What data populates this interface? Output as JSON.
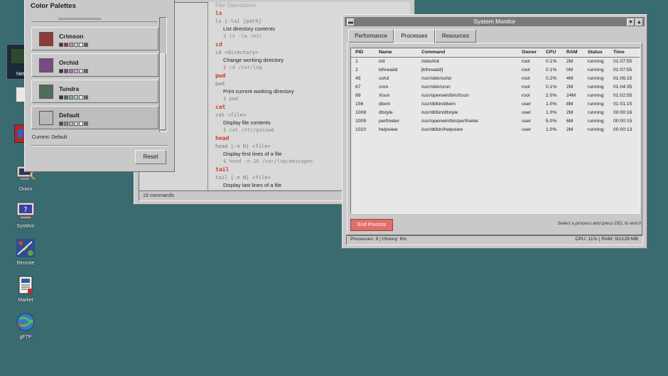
{
  "desktop": {
    "icons": [
      {
        "label": "Onion",
        "icon": "onion-icon"
      },
      {
        "label": "SysMon",
        "icon": "sysmon-icon"
      },
      {
        "label": "Remote",
        "icon": "remote-icon"
      },
      {
        "label": "Market",
        "icon": "market-icon"
      },
      {
        "label": "gFTP",
        "icon": "gftp-icon"
      }
    ],
    "partial_icons": [
      {
        "label": "Net",
        "icon": "netscape-icon"
      }
    ]
  },
  "commands_window": {
    "header": "File Operations",
    "status": "19 commands",
    "commands": [
      {
        "name": "ls",
        "syntax": "ls [-la] [path]",
        "desc": "List directory contents",
        "example": "$ ls -la /etc"
      },
      {
        "name": "cd",
        "syntax": "cd <directory>",
        "desc": "Change working directory",
        "example": "$ cd /var/log"
      },
      {
        "name": "pwd",
        "syntax": "pwd",
        "desc": "Print current working directory",
        "example": "$ pwd"
      },
      {
        "name": "cat",
        "syntax": "cat <file>",
        "desc": "Display file contents",
        "example": "$ cat /etc/passwd"
      },
      {
        "name": "head",
        "syntax": "head [-n N] <file>",
        "desc": "Display first lines of a file",
        "example": "$ head -n 20 /var/log/messages"
      },
      {
        "name": "tail",
        "syntax": "tail [-n N] <file>",
        "desc": "Display last lines of a file",
        "example": ""
      }
    ]
  },
  "palette_window": {
    "title": "Color Palettes",
    "palettes": [
      {
        "name": "Crimson",
        "swatch": "#8e3a3a",
        "dots": [
          "#5a2a2a",
          "#8e3a3a",
          "#c98c8c",
          "#e0c4c4",
          "#f2e8e8",
          "#7a5a5a"
        ]
      },
      {
        "name": "Orchid",
        "swatch": "#7a4a85",
        "dots": [
          "#3a2a45",
          "#7a4a85",
          "#a07ab0",
          "#c8aed2",
          "#e6daea",
          "#6a5a72"
        ]
      },
      {
        "name": "Tundra",
        "swatch": "#4f6e5c",
        "dots": [
          "#2a3a30",
          "#4f6e5c",
          "#8aa896",
          "#b8cbbf",
          "#e2ebe5",
          "#5a6a60"
        ]
      },
      {
        "name": "Default",
        "swatch": "#b8b8b8",
        "dots": [
          "#4a4a4a",
          "#8a8a8a",
          "#b8b8b8",
          "#d8d8d8",
          "#f2f2f2",
          "#6a6a6a"
        ]
      }
    ],
    "current": "Current: Default",
    "reset_label": "Reset"
  },
  "sysmon": {
    "title": "System Monitor",
    "tabs": [
      "Performance",
      "Processes",
      "Resources"
    ],
    "active_tab": "Processes",
    "columns": [
      "PID",
      "Name",
      "Command",
      "Owner",
      "CPU",
      "RAM",
      "Status",
      "Time"
    ],
    "rows": [
      [
        "1",
        "init",
        "/sbin/init",
        "root",
        "0.1%",
        "2M",
        "running",
        "01:07:55"
      ],
      [
        "2",
        "kthreadd",
        "[kthreadd]",
        "root",
        "0.1%",
        "0M",
        "running",
        "01:07:55"
      ],
      [
        "45",
        "sshd",
        "/usr/sbin/sshd",
        "root",
        "0.2%",
        "4M",
        "running",
        "01:06:15"
      ],
      [
        "67",
        "cron",
        "/usr/sbin/cron",
        "root",
        "0.1%",
        "2M",
        "running",
        "01:04:35"
      ],
      [
        "89",
        "Xsun",
        "/usr/openwin/bin/Xsun",
        "root",
        "2.0%",
        "24M",
        "running",
        "01:02:55"
      ],
      [
        "156",
        "dtwm",
        "/usr/dt/bin/dtwm",
        "user",
        "1.0%",
        "8M",
        "running",
        "01:01:15"
      ],
      [
        "1008",
        "dtstyle",
        "/usr/dt/bin/dtstyle",
        "user",
        "1.0%",
        "2M",
        "running",
        "00:00:16"
      ],
      [
        "1009",
        "perfmeter",
        "/usr/openwin/bin/perfmeter",
        "user",
        "5.0%",
        "6M",
        "running",
        "00:00:15"
      ],
      [
        "1010",
        "helpview",
        "/usr/dt/bin/helpview",
        "user",
        "1.0%",
        "2M",
        "running",
        "00:00:13"
      ]
    ],
    "end_process_label": "End Process",
    "hint": "Select a process and press DEL to end it",
    "status_left": "Processes: 9 | History: 8m",
    "status_right": "CPU: 11% | RAM: 50/128 MB",
    "colors": {
      "end_button": "#e06f6b",
      "titlebar": "#7a7a7a"
    }
  }
}
